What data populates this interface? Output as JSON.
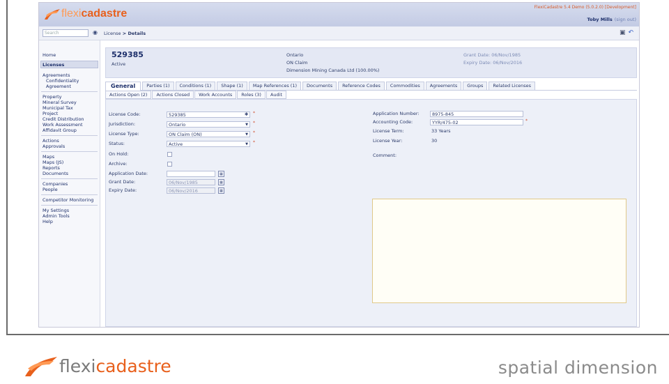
{
  "app": {
    "logo_flexi": "flexi",
    "logo_cad": "cadastre",
    "version_text": "FlexiCadastre 5.4 Demo (5.0.2.0) [Development]",
    "user_name": "Toby Mills",
    "sign_out": "(sign out)"
  },
  "toolbar": {
    "search_placeholder": "Search",
    "breadcrumb_parent": "License",
    "breadcrumb_sep": " > ",
    "breadcrumb_current": "Details"
  },
  "sidebar": {
    "items": [
      "Home",
      "Licenses",
      "Agreements",
      "Confidentiality",
      "Agreement",
      "Property",
      "Mineral Survey",
      "Municipal Tax",
      "Project",
      "Credit Distribution",
      "Work Assessment",
      "Affidavit Group",
      "Actions",
      "Approvals",
      "Maps",
      "Maps (JS)",
      "Reports",
      "Documents",
      "Companies",
      "People",
      "Competitor Monitoring",
      "My Settings",
      "Admin Tools",
      "Help"
    ]
  },
  "summary": {
    "license_number": "529385",
    "status": "Active",
    "jurisdiction": "Ontario",
    "type": "ON Claim",
    "holder": "Dimension Mining Canada Ltd (100.00%)",
    "grant_date": "Grant Date: 06/Nov/1985",
    "expiry_date": "Expiry Date: 06/Nov/2016"
  },
  "tabs": [
    "General",
    "Parties (1)",
    "Conditions (1)",
    "Shape (1)",
    "Map References (1)",
    "Documents",
    "Reference Codes",
    "Commodities",
    "Agreements",
    "Groups",
    "Related Licenses"
  ],
  "subtabs": [
    "Actions Open (2)",
    "Actions Closed",
    "Work Accounts",
    "Roles (3)",
    "Audit"
  ],
  "form": {
    "license_code_label": "License Code:",
    "license_code": "529385",
    "jurisdiction_label": "Jurisdiction:",
    "jurisdiction": "Ontario",
    "license_type_label": "License Type:",
    "license_type": "ON Claim (ON)",
    "status_label": "Status:",
    "status": "Active",
    "on_hold_label": "On Hold:",
    "archive_label": "Archive:",
    "application_date_label": "Application Date:",
    "application_date": "",
    "grant_date_label": "Grant Date:",
    "grant_date": "06/Nov/1985",
    "expiry_date_label": "Expiry Date:",
    "expiry_date": "06/Nov/2016",
    "application_number_label": "Application Number:",
    "application_number": "8975-845",
    "accounting_code_label": "Accounting Code:",
    "accounting_code": "YYR/475-02",
    "license_term_label": "License Term:",
    "license_term": "33 Years",
    "license_year_label": "License Year:",
    "license_year": "30",
    "comment_label": "Comment:",
    "required_mark": "*"
  },
  "footer": {
    "logo_flexi": "flexi",
    "logo_cad": "cadastre",
    "spatial": "spatial dimension"
  },
  "colors": {
    "brand_orange": "#e8601c",
    "nav_blue": "#1c2e6a",
    "header_bg": "#c3cbe4"
  }
}
